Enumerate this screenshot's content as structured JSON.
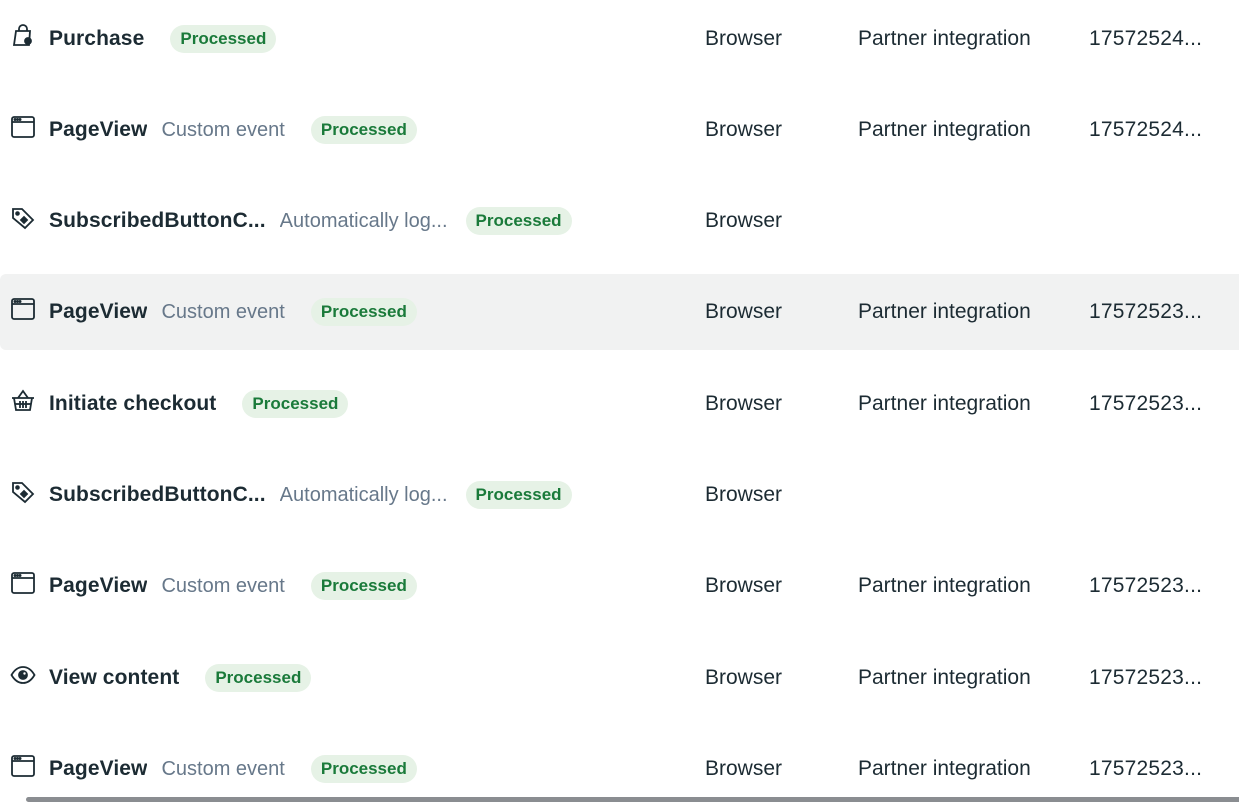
{
  "rows": [
    {
      "icon": "shopping-bag-icon",
      "name": "Purchase",
      "sub": "",
      "status": "Processed",
      "source": "Browser",
      "integration": "Partner integration",
      "event_id": "17572524..."
    },
    {
      "icon": "browser-window-icon",
      "name": "PageView",
      "sub": "Custom event",
      "status": "Processed",
      "source": "Browser",
      "integration": "Partner integration",
      "event_id": "17572524..."
    },
    {
      "icon": "tag-icon",
      "name": "SubscribedButtonC...",
      "sub": "Automatically log...",
      "status": "Processed",
      "source": "Browser",
      "integration": "",
      "event_id": ""
    },
    {
      "icon": "browser-window-icon",
      "name": "PageView",
      "sub": "Custom event",
      "status": "Processed",
      "source": "Browser",
      "integration": "Partner integration",
      "event_id": "17572523..."
    },
    {
      "icon": "basket-icon",
      "name": "Initiate checkout",
      "sub": "",
      "status": "Processed",
      "source": "Browser",
      "integration": "Partner integration",
      "event_id": "17572523..."
    },
    {
      "icon": "tag-icon",
      "name": "SubscribedButtonC...",
      "sub": "Automatically log...",
      "status": "Processed",
      "source": "Browser",
      "integration": "",
      "event_id": ""
    },
    {
      "icon": "browser-window-icon",
      "name": "PageView",
      "sub": "Custom event",
      "status": "Processed",
      "source": "Browser",
      "integration": "Partner integration",
      "event_id": "17572523..."
    },
    {
      "icon": "eye-icon",
      "name": "View content",
      "sub": "",
      "status": "Processed",
      "source": "Browser",
      "integration": "Partner integration",
      "event_id": "17572523..."
    },
    {
      "icon": "browser-window-icon",
      "name": "PageView",
      "sub": "Custom event",
      "status": "Processed",
      "source": "Browser",
      "integration": "Partner integration",
      "event_id": "17572523..."
    }
  ],
  "colors": {
    "badge_bg": "#e6f2e6",
    "badge_text": "#1a7a3a",
    "row_highlight": "#f1f2f2",
    "text_primary": "#1c2b33",
    "text_secondary": "#67788a"
  },
  "highlighted_row": 4
}
